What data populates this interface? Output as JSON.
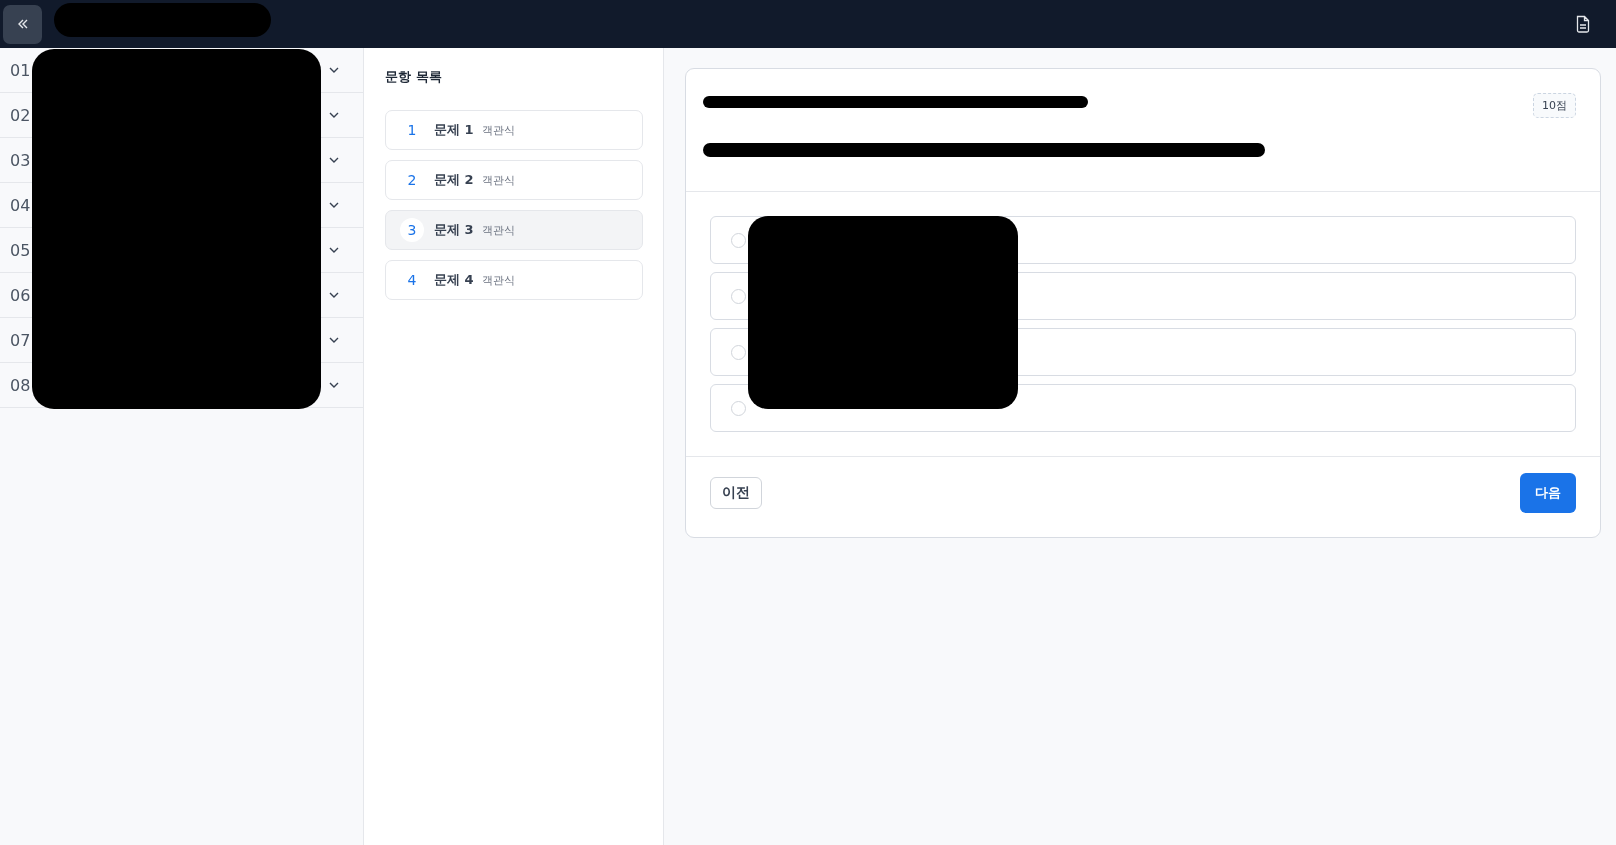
{
  "sidebar": {
    "sections": [
      {
        "number": "01",
        "expanded": false
      },
      {
        "number": "02",
        "expanded": false
      },
      {
        "number": "03",
        "expanded": false
      },
      {
        "number": "04",
        "expanded": false
      },
      {
        "number": "05",
        "expanded": false
      },
      {
        "number": "06",
        "expanded": false
      },
      {
        "number": "07",
        "expanded": false
      },
      {
        "number": "08",
        "expanded": false
      }
    ]
  },
  "question_list": {
    "title": "문항 목록",
    "items": [
      {
        "number": "1",
        "label": "문제 1",
        "type": "객관식",
        "selected": false
      },
      {
        "number": "2",
        "label": "문제 2",
        "type": "객관식",
        "selected": false
      },
      {
        "number": "3",
        "label": "문제 3",
        "type": "객관식",
        "selected": true
      },
      {
        "number": "4",
        "label": "문제 4",
        "type": "객관식",
        "selected": false
      }
    ]
  },
  "question": {
    "score": "10점",
    "options": [
      {
        "selected": false
      },
      {
        "selected": false
      },
      {
        "selected": false
      },
      {
        "selected": false
      }
    ],
    "prev_button": "이전",
    "next_button": "다음"
  }
}
